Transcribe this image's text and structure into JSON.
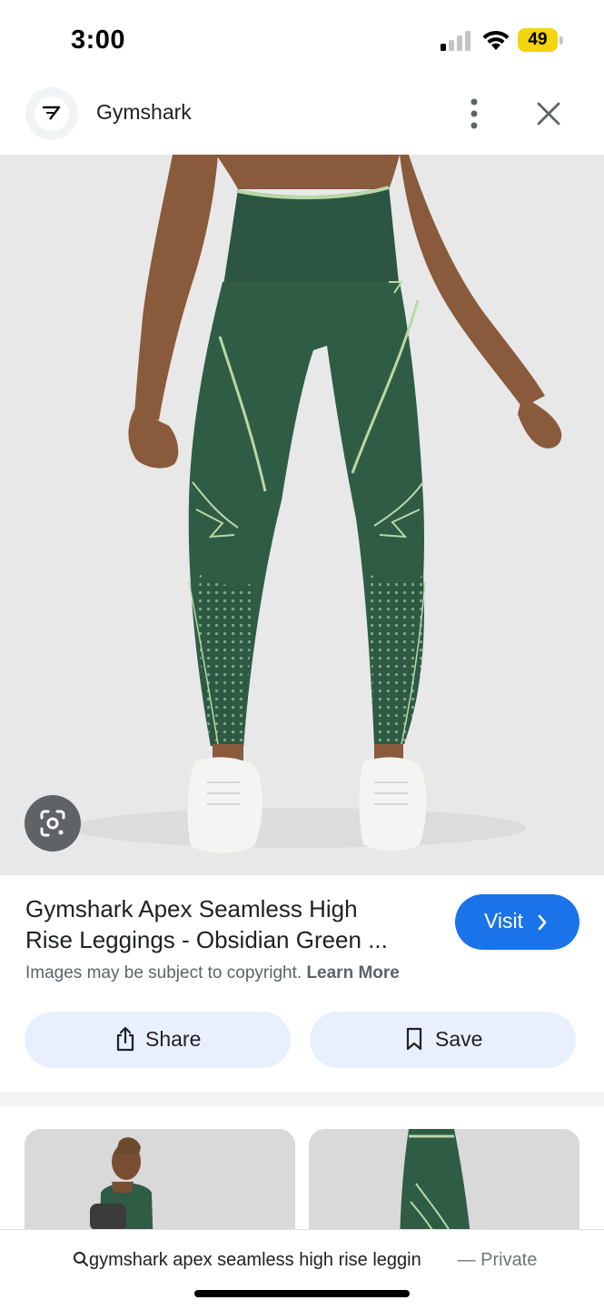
{
  "status_bar": {
    "time": "3:00",
    "battery": "49",
    "icons": [
      "cellular-signal-icon",
      "wifi-icon",
      "battery-icon"
    ]
  },
  "header": {
    "site_name": "Gymshark",
    "logo_icon": "gymshark-logo-icon",
    "more_icon": "more-vert-icon",
    "close_icon": "close-icon"
  },
  "hero": {
    "lens_icon": "google-lens-icon"
  },
  "product": {
    "title_line1": "Gymshark Apex Seamless High",
    "title_line2": "Rise Leggings - Obsidian Green ...",
    "visit_label": "Visit",
    "copyright_text": "Images may be subject to copyright.",
    "learn_more": "Learn More"
  },
  "actions": {
    "share_label": "Share",
    "save_label": "Save"
  },
  "bottom_bar": {
    "query": "gymshark apex seamless high rise leggin",
    "private_label": "— Private"
  },
  "colors": {
    "accent": "#1a73e8",
    "chip_bg": "#e8f0fe",
    "legging_green": "#2f5c45",
    "legging_trim": "#b9d8a8"
  }
}
